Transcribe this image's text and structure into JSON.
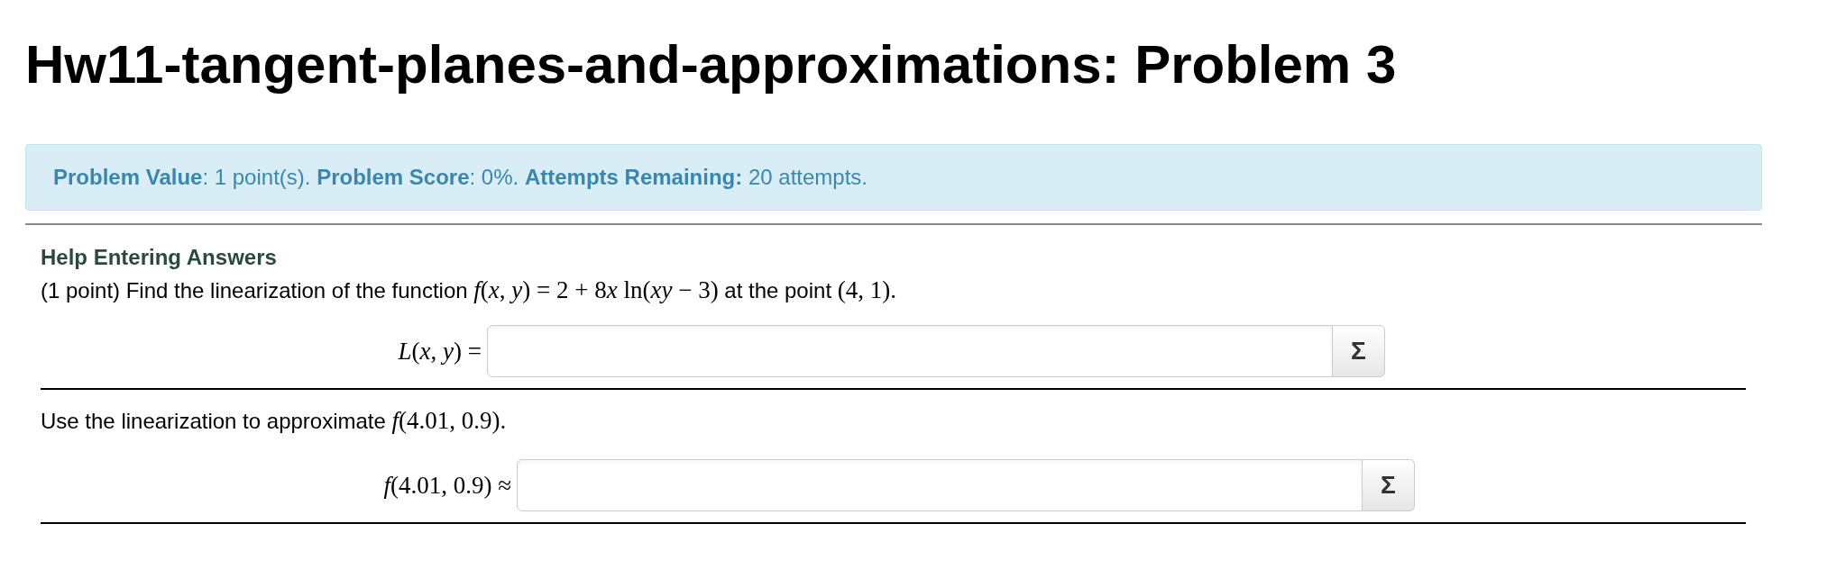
{
  "title": "Hw11-tangent-planes-and-approximations: Problem 3",
  "info_bar": "**Problem Value**: 1 point(s). **Problem Score**: 0%. **Attempts Remaining:** 20 attempts.",
  "help_link": "Help Entering Answers",
  "problem_text": [
    {
      "kind": "text",
      "text": "(1 point) Find the linearization of the function "
    },
    {
      "kind": "math",
      "text": "*f*(*x*, *y*) = 2 + 8"
    },
    {
      "kind": "math",
      "text": "*x* ln(*xy* − 3)"
    },
    {
      "kind": "text",
      "text": " at the point "
    },
    {
      "kind": "math",
      "text": "(4, 1)."
    }
  ],
  "answers": [
    {
      "label": "*L*(*x*, *y*) =",
      "button": "Σ",
      "prompt": [
        {
          "kind": "text",
          "text": "Use the linearization to approximate "
        },
        {
          "kind": "math",
          "text": "*f*(4.01, 0.9)."
        }
      ]
    },
    {
      "label": "*f*(4.01, 0.9) ≈",
      "button": "Σ"
    }
  ]
}
